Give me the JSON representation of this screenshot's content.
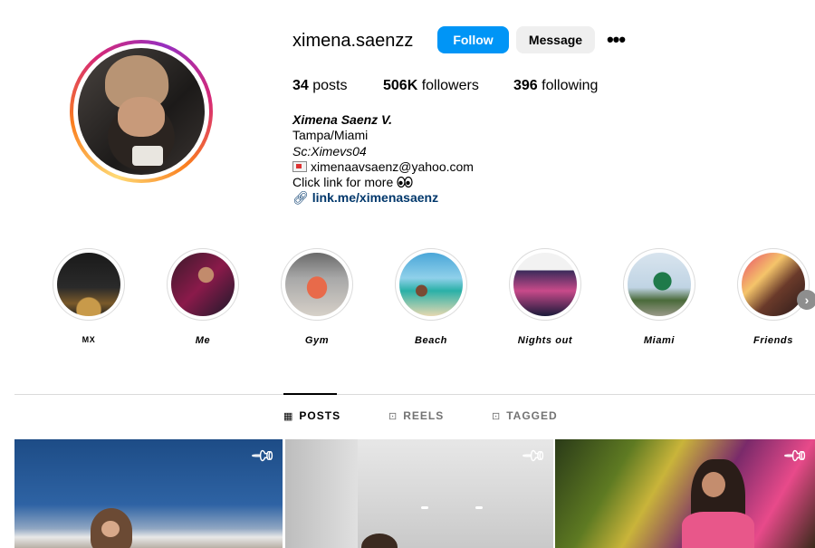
{
  "profile": {
    "username": "ximena.saenzz",
    "follow_label": "Follow",
    "message_label": "Message",
    "more_label": "•••",
    "stats": {
      "posts_count": "34",
      "posts_label": "posts",
      "followers_count": "506K",
      "followers_label": "followers",
      "following_count": "396",
      "following_label": "following"
    },
    "bio": {
      "name": "Ximena Saenz V.",
      "line1": "Tampa/Miami",
      "line2": "Sc:Ximevs04",
      "email": "ximenaavsaenz@yahoo.com",
      "line4": "Click link for more",
      "link": "link.me/ximenasaenz"
    }
  },
  "highlights": [
    {
      "label": "MX",
      "icon": "highlight-mx"
    },
    {
      "label": "Me",
      "icon": "highlight-me"
    },
    {
      "label": "Gym",
      "icon": "highlight-gym"
    },
    {
      "label": "Beach",
      "icon": "highlight-beach"
    },
    {
      "label": "Nights out",
      "icon": "highlight-nights-out"
    },
    {
      "label": "Miami",
      "icon": "highlight-miami"
    },
    {
      "label": "Friends",
      "icon": "highlight-friends"
    }
  ],
  "tabs": [
    {
      "label": "POSTS",
      "icon": "grid-icon",
      "active": true
    },
    {
      "label": "REELS",
      "icon": "reels-icon",
      "active": false
    },
    {
      "label": "TAGGED",
      "icon": "tagged-icon",
      "active": false
    }
  ],
  "posts": [
    {
      "pinned": true
    },
    {
      "pinned": true
    },
    {
      "pinned": true
    }
  ],
  "colors": {
    "follow_button": "#0095f6",
    "message_button": "#efefef",
    "link": "#00376b",
    "muted_text": "#737373",
    "divider": "#dbdbdb"
  }
}
